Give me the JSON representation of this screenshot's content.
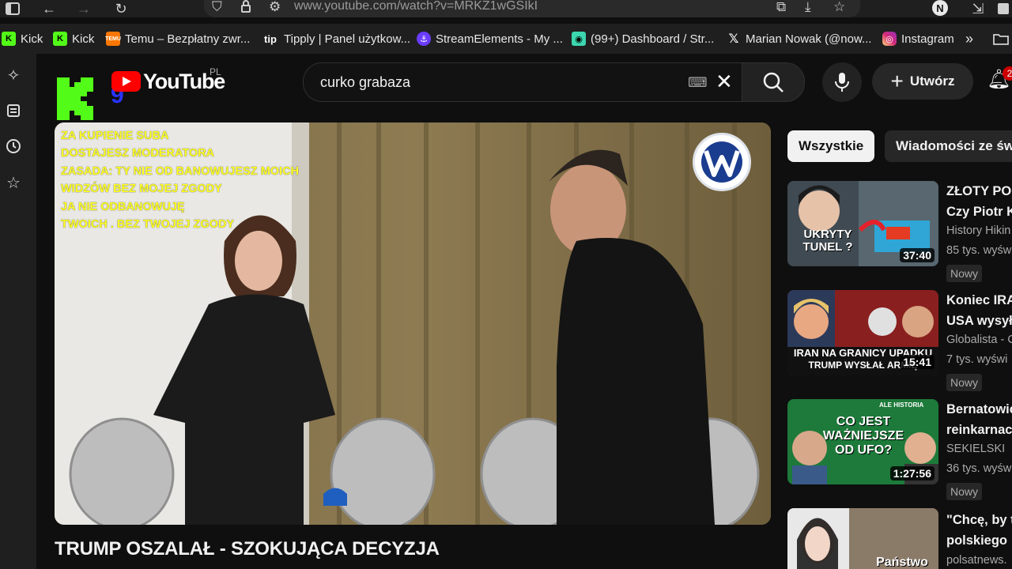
{
  "browser": {
    "url": "www.youtube.com/watch?v=MRKZ1wGSIkI",
    "profile_initial": "N"
  },
  "bookmarks": [
    {
      "label": "Kick",
      "icon": "kick-icon",
      "color": "#53fc18"
    },
    {
      "label": "Kick",
      "icon": "kick-icon",
      "color": "#53fc18"
    },
    {
      "label": "Temu – Bezpłatny zwr...",
      "icon": "temu-icon",
      "color": "#fb7701"
    },
    {
      "label": "Tipply | Panel użytkow...",
      "icon": "tipply-icon",
      "color": "#ffffff"
    },
    {
      "label": "StreamElements - My ...",
      "icon": "streamelements-icon",
      "color": "#6a3cff"
    },
    {
      "label": "(99+) Dashboard / Str...",
      "icon": "dashboard-icon",
      "color": "#3cd6b0"
    },
    {
      "label": "Marian Nowak (@now...",
      "icon": "x-icon",
      "color": "#ffffff"
    },
    {
      "label": "Instagram",
      "icon": "instagram-icon",
      "color": "#e1306c"
    }
  ],
  "youtube": {
    "logo_text": "YouTube",
    "country_code": "PL",
    "search_query": "curko grabaza",
    "create_label": "Utwórz",
    "notification_count": "2"
  },
  "video": {
    "title": "TRUMP OSZALAŁ - SZOKUJĄCA DECYZJA",
    "overlay_lines": [
      "ZA KUPIENIE SUBA",
      "DOSTAJESZ MODERATORA",
      "ZASADA: TY NIE OD BANOWUJESZ MOICH",
      "WIDZÓW BEZ MOJEJ ZGODY",
      "JA NIE ODBANOWUJĘ",
      "TWOICH . BEZ TWOJEJ ZGODY"
    ]
  },
  "chips": [
    {
      "label": "Wszystkie",
      "active": true
    },
    {
      "label": "Wiadomości ze św",
      "active": false
    }
  ],
  "recommendations": [
    {
      "title_line1": "ZŁOTY POC",
      "title_line2": "Czy Piotr K",
      "channel": "History Hikin",
      "meta": "85 tys. wyśw",
      "badge": "Nowy",
      "duration": "37:40",
      "thumb_text": "UKRYTY TUNEL ?"
    },
    {
      "title_line1": "Koniec IRA",
      "title_line2": "USA wysyła",
      "channel": "Globalista - C",
      "meta": "7 tys. wyświ",
      "badge": "Nowy",
      "duration": "15:41",
      "thumb_text": "IRAN NA GRANICY UPADKU",
      "thumb_text2": "TRUMP WYSŁAŁ ARMIĘ"
    },
    {
      "title_line1": "Bernatowic",
      "title_line2": "reinkarnac",
      "channel": "SEKIELSKI",
      "meta": "36 tys. wyśw",
      "badge": "Nowy",
      "duration": "1:27:56",
      "thumb_text": "CO JEST WAŻNIEJSZE OD UFO?",
      "thumb_label": "ALE HISTORIA"
    },
    {
      "title_line1": "\"Chcę, by t",
      "title_line2": "polskiego",
      "channel": "polsatnews.",
      "thumb_text": "Państwo"
    }
  ]
}
